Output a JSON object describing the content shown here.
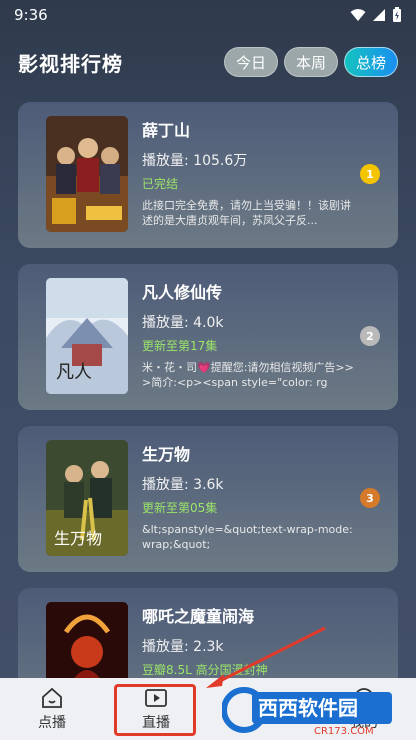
{
  "status_bar": {
    "time": "9:36"
  },
  "header": {
    "title": "影视排行榜",
    "tabs": [
      {
        "label": "今日",
        "active": false
      },
      {
        "label": "本周",
        "active": false
      },
      {
        "label": "总榜",
        "active": true
      }
    ]
  },
  "items": [
    {
      "title": "薛丁山",
      "plays": "播放量: 105.6万",
      "status": "已完结",
      "desc": "此接口完全免费，请勿上当受骗！！该剧讲述的是大唐贞观年间，苏凤父子反...",
      "rank": "1"
    },
    {
      "title": "凡人修仙传",
      "plays": "播放量: 4.0k",
      "status": "更新至第17集",
      "desc": "米・花・司💗提醒您:请勿相信视频广告>>>简介:<p><span style=\"color: rg",
      "rank": "2"
    },
    {
      "title": "生万物",
      "plays": "播放量: 3.6k",
      "status": "更新至第05集",
      "desc": "&lt;spanstyle=&quot;text-wrap-mode:wrap;&quot;",
      "rank": "3"
    },
    {
      "title": "哪吒之魔童闹海",
      "plays": "播放量: 2.3k",
      "status": "豆瓣8.5L 高分国漫封神",
      "desc": "",
      "rank": ""
    }
  ],
  "bottom_nav": [
    {
      "label": "点播",
      "icon": "home-icon"
    },
    {
      "label": "直播",
      "icon": "play-icon"
    },
    {
      "label": "",
      "icon": ""
    },
    {
      "label": "我的",
      "icon": "user-icon"
    }
  ],
  "watermark": {
    "text": "西西软件园",
    "sub": "CR173.COM"
  },
  "colors": {
    "accent_tab": "#1a8ff0",
    "status_green": "#9be56a",
    "rank_gold": "#f5c400",
    "rank_silver": "#b9b9b9",
    "rank_bronze": "#d47a2a",
    "highlight_red": "#e23a2a"
  }
}
